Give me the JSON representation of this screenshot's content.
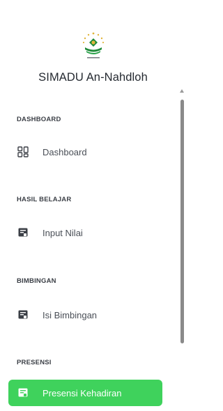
{
  "app": {
    "title": "SIMADU An-Nahdloh"
  },
  "colors": {
    "accent": "#3fd25c",
    "logo_green": "#1f8a3a",
    "logo_gold": "#e2b53c"
  },
  "sections": [
    {
      "title": "DASHBOARD",
      "item": {
        "label": "Dashboard",
        "icon": "dashboard-grid-icon",
        "active": false
      }
    },
    {
      "title": "HASIL BELAJAR",
      "item": {
        "label": "Input Nilai",
        "icon": "document-icon",
        "active": false
      }
    },
    {
      "title": "BIMBINGAN",
      "item": {
        "label": "Isi Bimbingan",
        "icon": "document-icon",
        "active": false
      }
    },
    {
      "title": "PRESENSI",
      "item": {
        "label": "Presensi Kehadiran",
        "icon": "document-icon",
        "active": true
      }
    }
  ]
}
